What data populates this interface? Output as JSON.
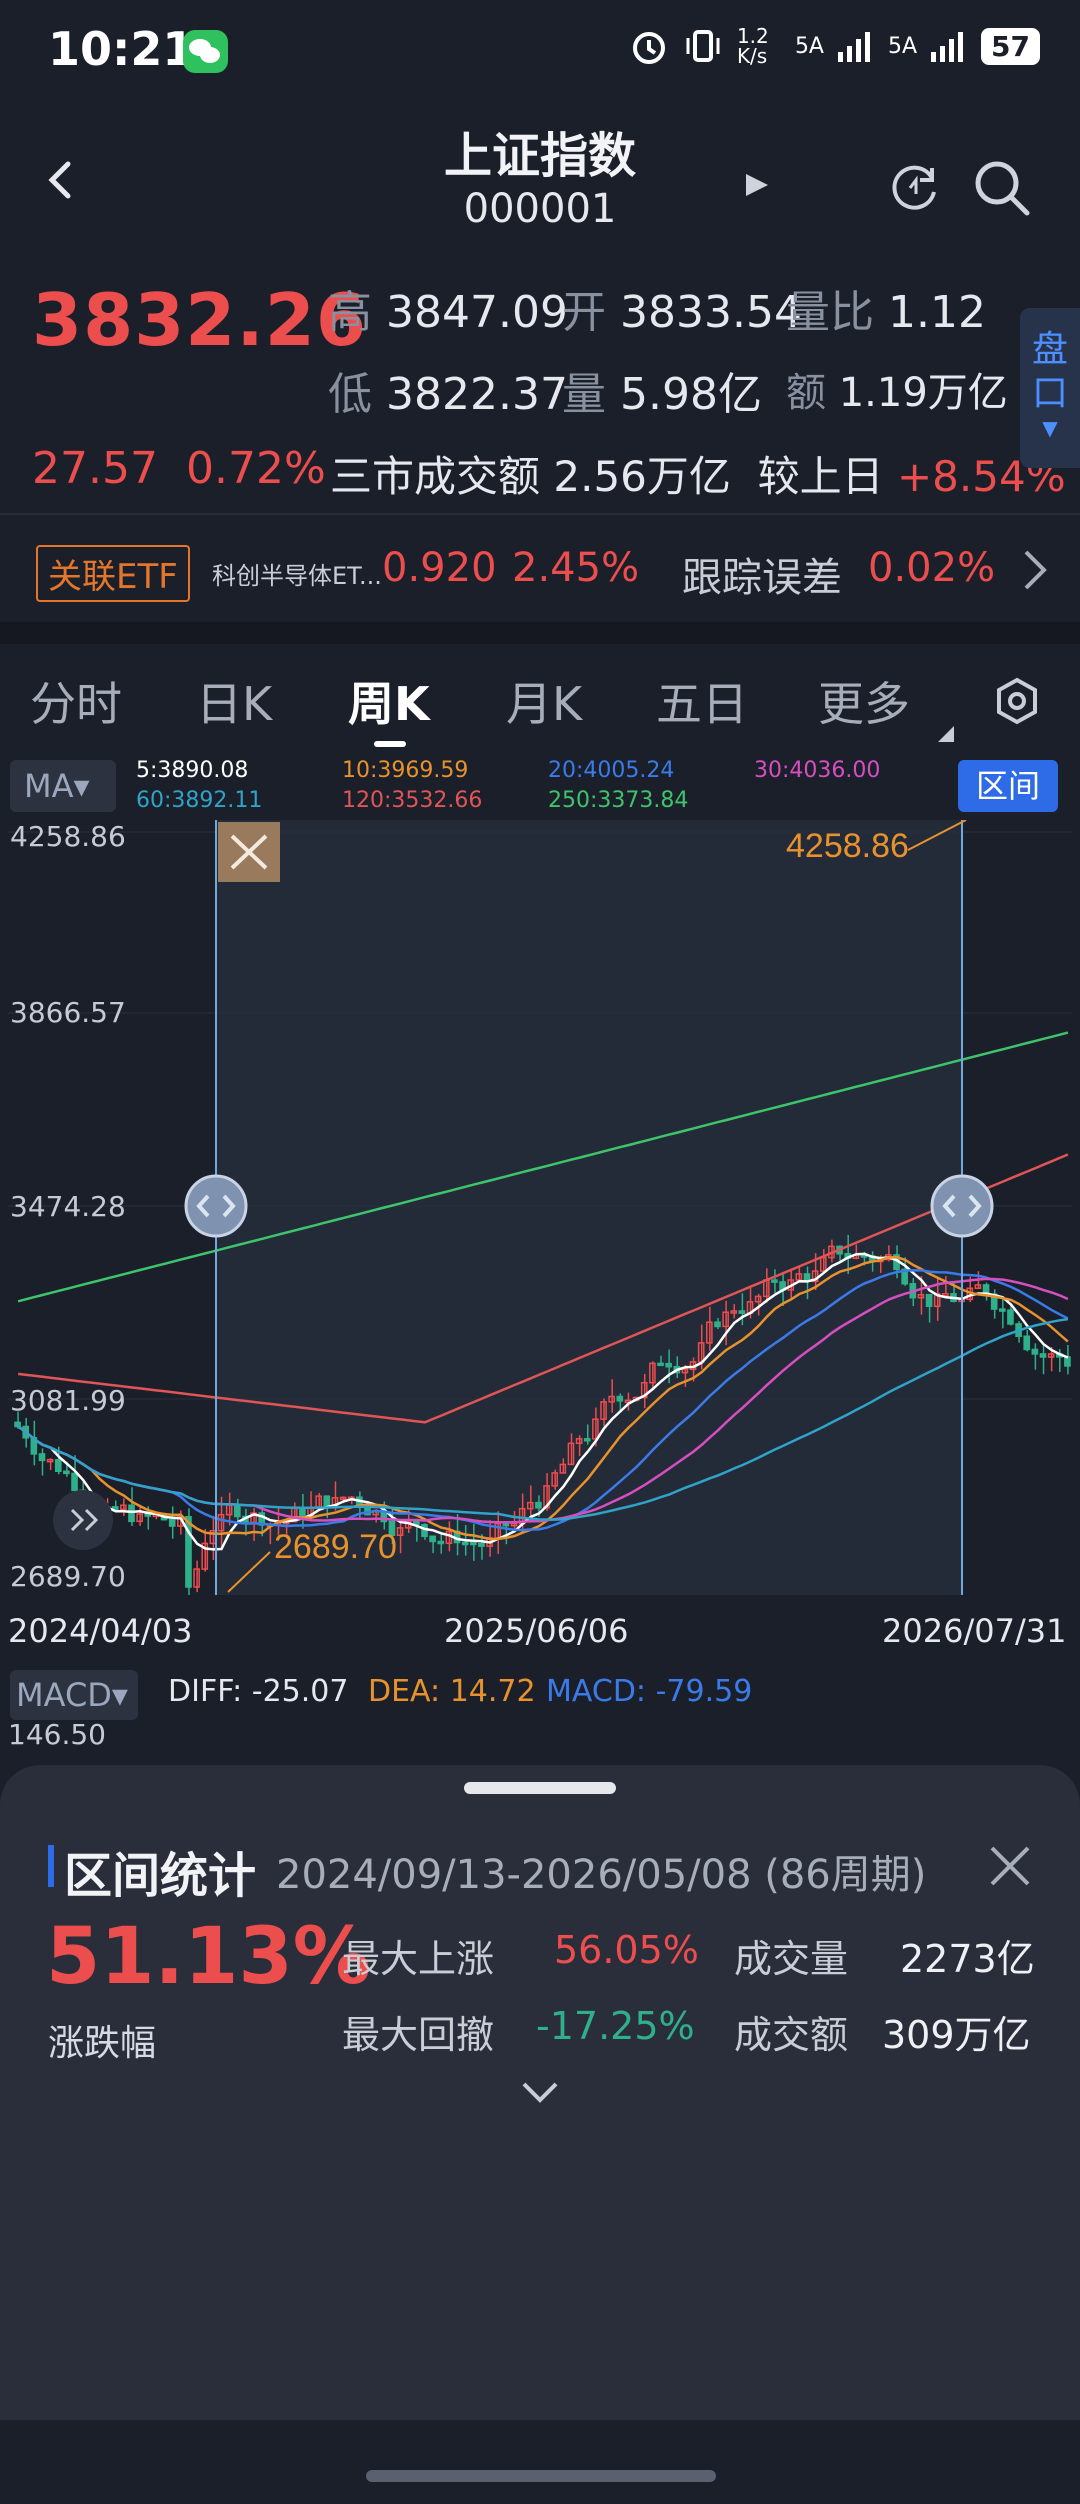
{
  "status_bar": {
    "time": "10:21",
    "net_speed": "1.2 K/s",
    "signal1": "5A",
    "signal2": "5A",
    "battery": "57"
  },
  "header": {
    "title": "上证指数",
    "code": "000001"
  },
  "quote": {
    "price": "3832.26",
    "high_label": "高",
    "high": "3847.09",
    "open_label": "开",
    "open": "3833.54",
    "vol_ratio_label": "量比",
    "vol_ratio": "1.12",
    "low_label": "低",
    "low": "3822.37",
    "volume_label": "量",
    "volume": "5.98亿",
    "amount_label": "额",
    "amount": "1.19万亿",
    "change": "27.57",
    "change_pct": "0.72%",
    "turnover_label": "三市成交额",
    "turnover": "2.56万亿",
    "compare_label": "较上日",
    "compare": "+8.54%",
    "pankou": "盘口"
  },
  "etf": {
    "badge": "关联ETF",
    "name": "科创半导体ET...",
    "price": "0.920",
    "pct": "2.45%",
    "track_label": "跟踪误差",
    "track_value": "0.02%"
  },
  "tabs": [
    {
      "label": "分时"
    },
    {
      "label": "日K"
    },
    {
      "label": "周K"
    },
    {
      "label": "月K"
    },
    {
      "label": "五日"
    },
    {
      "label": "更多"
    }
  ],
  "ma": {
    "chip": "MA▾",
    "interval": "区间",
    "items": [
      {
        "text": "5:3890.08",
        "color": "#ffffff"
      },
      {
        "text": "10:3969.59",
        "color": "#e8922e"
      },
      {
        "text": "20:4005.24",
        "color": "#3b7be8"
      },
      {
        "text": "30:4036.00",
        "color": "#d64fc0"
      },
      {
        "text": "60:3892.11",
        "color": "#2fa3c8"
      },
      {
        "text": "120:3532.66",
        "color": "#e05555"
      },
      {
        "text": "250:3373.84",
        "color": "#3ec46b"
      }
    ]
  },
  "chart_data": {
    "type": "candlestick",
    "y_ticks": [
      "4258.86",
      "3866.57",
      "3474.28",
      "3081.99",
      "2689.70"
    ],
    "ylim": [
      2689.7,
      4258.86
    ],
    "x_ticks": [
      "2024/04/03",
      "2025/06/06",
      "2026/07/31"
    ],
    "annotations": [
      {
        "text": "4258.86",
        "kind": "max"
      },
      {
        "text": "2689.70",
        "kind": "min"
      }
    ],
    "colors": {
      "up": "#ec4d4d",
      "down": "#2fb08a"
    }
  },
  "macd": {
    "chip": "MACD▾",
    "diff": "DIFF: -25.07",
    "dea": "DEA: 14.72",
    "macd": "MACD: -79.59",
    "top": "146.50"
  },
  "panel": {
    "title": "区间统计",
    "range": "2024/09/13-2026/05/08 (86周期)",
    "pct": "51.13%",
    "pct_label": "涨跌幅",
    "max_up_label": "最大上涨",
    "max_up": "56.05%",
    "max_dd_label": "最大回撤",
    "max_dd": "-17.25%",
    "vol_label": "成交量",
    "vol": "2273亿",
    "amt_label": "成交额",
    "amt": "309万亿"
  }
}
